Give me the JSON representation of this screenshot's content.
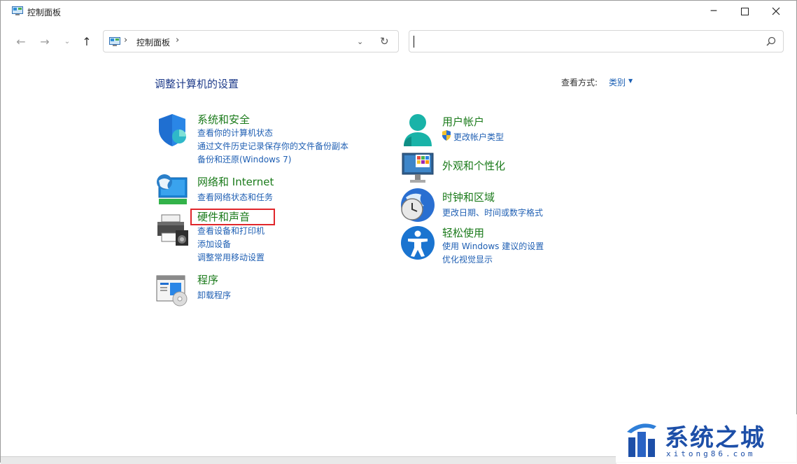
{
  "window": {
    "title": "控制面板"
  },
  "address": {
    "crumb": "控制面板"
  },
  "search": {
    "placeholder": ""
  },
  "content": {
    "title": "调整计算机的设置",
    "view_label": "查看方式:",
    "view_value": "类别"
  },
  "categories": {
    "system": {
      "title": "系统和安全",
      "links": [
        "查看你的计算机状态",
        "通过文件历史记录保存你的文件备份副本",
        "备份和还原(Windows 7)"
      ]
    },
    "network": {
      "title": "网络和 Internet",
      "links": [
        "查看网络状态和任务"
      ]
    },
    "hardware": {
      "title": "硬件和声音",
      "links": [
        "查看设备和打印机",
        "添加设备",
        "调整常用移动设置"
      ]
    },
    "programs": {
      "title": "程序",
      "links": [
        "卸载程序"
      ]
    },
    "users": {
      "title": "用户帐户",
      "links": [
        "更改帐户类型"
      ]
    },
    "appearance": {
      "title": "外观和个性化",
      "links": []
    },
    "clock": {
      "title": "时钟和区域",
      "links": [
        "更改日期、时间或数字格式"
      ]
    },
    "ease": {
      "title": "轻松使用",
      "links": [
        "使用 Windows 建议的设置",
        "优化视觉显示"
      ]
    }
  },
  "watermark": {
    "text": "系统之城",
    "url": "xitong86.com"
  },
  "colors": {
    "category_title": "#1a7a1a",
    "link": "#1f5fb3",
    "highlight": "#e0262b"
  }
}
